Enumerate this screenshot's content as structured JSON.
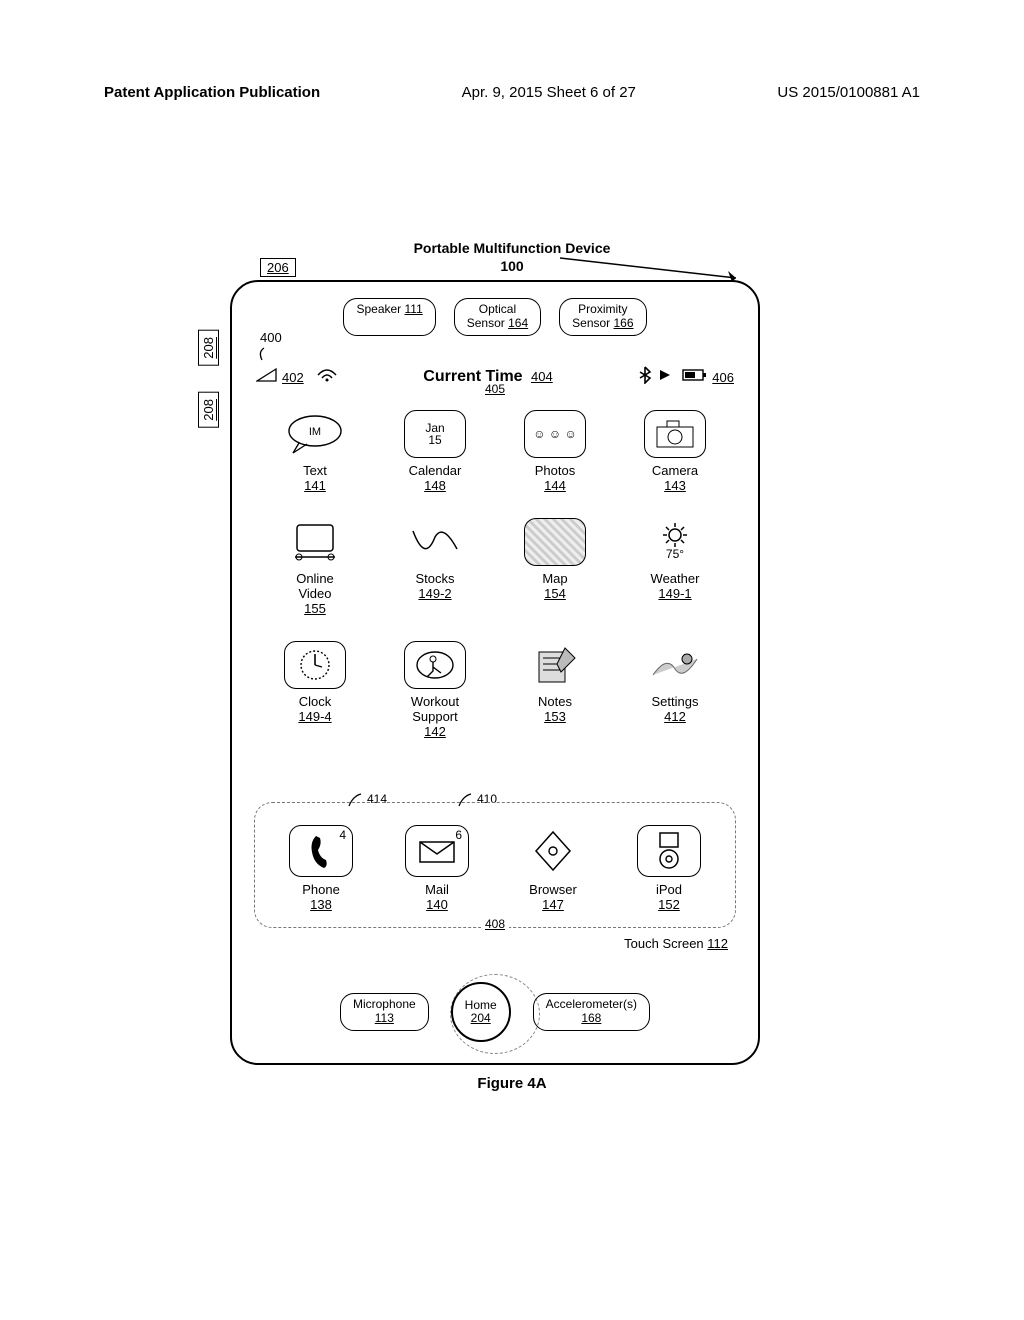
{
  "header": {
    "left": "Patent Application Publication",
    "mid": "Apr. 9, 2015   Sheet 6 of 27",
    "right": "US 2015/0100881 A1"
  },
  "title": {
    "line1": "Portable Multifunction Device",
    "line2": "100"
  },
  "refs": {
    "r206": "206",
    "r208": "208",
    "r400": "400"
  },
  "sensors": {
    "speaker": {
      "label": "Speaker ",
      "num": "111"
    },
    "optical": {
      "l1": "Optical",
      "l2": "Sensor ",
      "num": "164"
    },
    "prox": {
      "l1": "Proximity",
      "l2": "Sensor ",
      "num": "166"
    }
  },
  "statusbar": {
    "left_num": "402",
    "title": "Current Time",
    "title_num": "404",
    "under_num": "405",
    "right_num": "406"
  },
  "apps": {
    "row1": [
      {
        "badge": "IM",
        "label": "Text",
        "ref": "141"
      },
      {
        "badge": "Jan\n15",
        "label": "Calendar",
        "ref": "148"
      },
      {
        "badge": "☺ ☺ ☺",
        "label": "Photos",
        "ref": "144"
      },
      {
        "badge": "",
        "label": "Camera",
        "ref": "143"
      }
    ],
    "row2": [
      {
        "badge": "",
        "label": "Online\nVideo",
        "ref": "155"
      },
      {
        "badge": "",
        "label": "Stocks",
        "ref": "149-2"
      },
      {
        "badge": "",
        "label": "Map",
        "ref": "154"
      },
      {
        "badge": "75°",
        "label": "Weather",
        "ref": "149-1"
      }
    ],
    "row3": [
      {
        "badge": "",
        "label": "Clock",
        "ref": "149-4"
      },
      {
        "badge": "",
        "label": "Workout\nSupport",
        "ref": "142"
      },
      {
        "badge": "",
        "label": "Notes",
        "ref": "153"
      },
      {
        "badge": "",
        "label": "Settings",
        "ref": "412"
      }
    ]
  },
  "dock": {
    "apps": [
      {
        "badge": "4",
        "label": "Phone",
        "ref": "138"
      },
      {
        "badge": "6",
        "label": "Mail",
        "ref": "140"
      },
      {
        "badge": "",
        "label": "Browser",
        "ref": "147"
      },
      {
        "badge": "",
        "label": "iPod",
        "ref": "152"
      }
    ],
    "num": "408",
    "lead_a": "414",
    "lead_b": "410"
  },
  "touch": {
    "label": "Touch Screen ",
    "num": "112"
  },
  "bottom": {
    "mic": {
      "label": "Microphone",
      "num": "113"
    },
    "home": {
      "label": "Home",
      "num": "204"
    },
    "accel": {
      "label": "Accelerometer(s)",
      "num": "168"
    }
  },
  "caption": "Figure 4A"
}
